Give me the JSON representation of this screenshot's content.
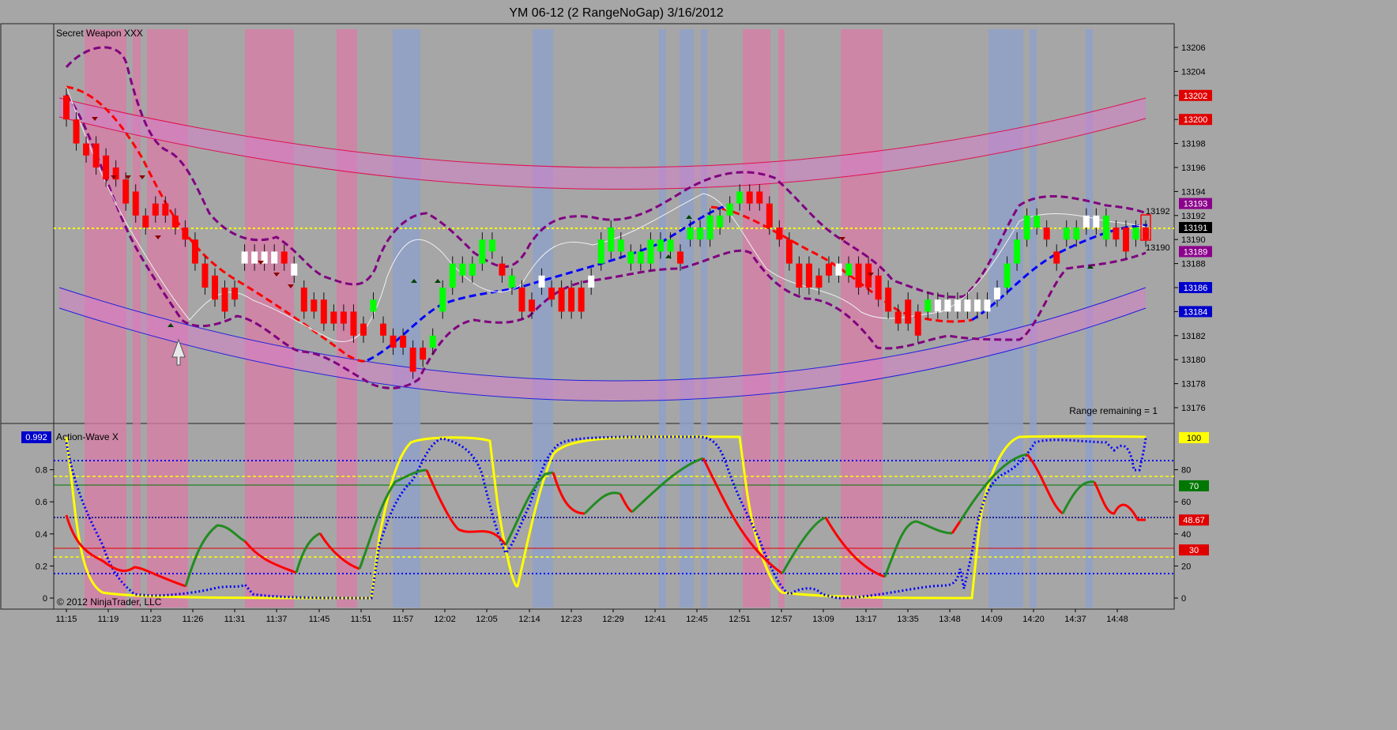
{
  "window": {
    "title": "YM 06-12 (2 RangeNoGap)  3/16/2012"
  },
  "price_panel": {
    "label": "Secret Weapon XXX",
    "range_text": "Range remaining = 1",
    "y_ticks": [
      "13206",
      "13204",
      "13202",
      "13200",
      "13198",
      "13196",
      "13194",
      "13192",
      "13190",
      "13188",
      "13186",
      "13184",
      "13182",
      "13180",
      "13178",
      "13176"
    ],
    "badges": [
      {
        "text": "13202",
        "color": "#e00000"
      },
      {
        "text": "13200",
        "color": "#e00000"
      },
      {
        "text": "13193",
        "color": "#8b008b"
      },
      {
        "text": "13191",
        "color": "#000000"
      },
      {
        "text": "13189",
        "color": "#8b008b"
      },
      {
        "text": "13186",
        "color": "#0000cc"
      },
      {
        "text": "13184",
        "color": "#0000cc"
      }
    ],
    "right_labels": [
      "13192",
      "13190"
    ]
  },
  "osc_panel": {
    "label": "Action-Wave X",
    "left_badge": "0.992",
    "copyright": "© 2012 NinjaTrader, LLC",
    "left_ticks": [
      "0.8",
      "0.6",
      "0.4",
      "0.2",
      "0"
    ],
    "right_ticks": [
      "80",
      "60",
      "40",
      "20",
      "0"
    ],
    "badges": [
      {
        "text": "100",
        "color": "#ffff00",
        "textColor": "#000000"
      },
      {
        "text": "70",
        "color": "#007700",
        "textColor": "#ffffff"
      },
      {
        "text": "48.67",
        "color": "#e00000",
        "textColor": "#ffffff"
      },
      {
        "text": "30",
        "color": "#e00000",
        "textColor": "#ffffff"
      }
    ]
  },
  "x_labels": [
    "11:15",
    "11:19",
    "11:23",
    "11:26",
    "11:31",
    "11:37",
    "11:45",
    "11:51",
    "11:57",
    "12:02",
    "12:05",
    "12:14",
    "12:23",
    "12:29",
    "12:41",
    "12:45",
    "12:51",
    "12:57",
    "13:09",
    "13:17",
    "13:35",
    "13:48",
    "14:09",
    "14:20",
    "14:37",
    "14:48"
  ],
  "chart_data": {
    "type": "candlestick",
    "title": "YM 06-12 (2 RangeNoGap)  3/16/2012",
    "price_range": [
      13175,
      13208
    ],
    "last_price": 13191,
    "colors": {
      "up": "#00ff00",
      "down": "#ff0000",
      "neutral": "#ffffff",
      "pink_zone": "#d97ba6",
      "blue_zone": "#8fa0c8"
    },
    "candles": [
      {
        "o": 13202,
        "c": 13200
      },
      {
        "o": 13200,
        "c": 13198
      },
      {
        "o": 13198,
        "c": 13197
      },
      {
        "o": 13198,
        "c": 13196
      },
      {
        "o": 13197,
        "c": 13195
      },
      {
        "o": 13196,
        "c": 13195
      },
      {
        "o": 13195,
        "c": 13193
      },
      {
        "o": 13194,
        "c": 13192
      },
      {
        "o": 13192,
        "c": 13191
      },
      {
        "o": 13193,
        "c": 13192
      },
      {
        "o": 13193,
        "c": 13192
      },
      {
        "o": 13192,
        "c": 13191
      },
      {
        "o": 13191,
        "c": 13190
      },
      {
        "o": 13190,
        "c": 13188
      },
      {
        "o": 13188,
        "c": 13186
      },
      {
        "o": 13187,
        "c": 13185
      },
      {
        "o": 13186,
        "c": 13184
      },
      {
        "o": 13186,
        "c": 13185
      },
      {
        "o": 13188,
        "c": 13189
      },
      {
        "o": 13188,
        "c": 13189
      },
      {
        "o": 13188,
        "c": 13189
      },
      {
        "o": 13188,
        "c": 13189
      },
      {
        "o": 13189,
        "c": 13188
      },
      {
        "o": 13187,
        "c": 13188
      },
      {
        "o": 13186,
        "c": 13184
      },
      {
        "o": 13185,
        "c": 13184
      },
      {
        "o": 13185,
        "c": 13183
      },
      {
        "o": 13184,
        "c": 13183
      },
      {
        "o": 13184,
        "c": 13183
      },
      {
        "o": 13184,
        "c": 13182
      },
      {
        "o": 13183,
        "c": 13182
      },
      {
        "o": 13184,
        "c": 13185
      },
      {
        "o": 13183,
        "c": 13182
      },
      {
        "o": 13182,
        "c": 13181
      },
      {
        "o": 13182,
        "c": 13181
      },
      {
        "o": 13181,
        "c": 13179
      },
      {
        "o": 13181,
        "c": 13180
      },
      {
        "o": 13181,
        "c": 13182
      },
      {
        "o": 13184,
        "c": 13186
      },
      {
        "o": 13186,
        "c": 13188
      },
      {
        "o": 13187,
        "c": 13188
      },
      {
        "o": 13187,
        "c": 13188
      },
      {
        "o": 13188,
        "c": 13190
      },
      {
        "o": 13189,
        "c": 13190
      },
      {
        "o": 13188,
        "c": 13187
      },
      {
        "o": 13186,
        "c": 13187
      },
      {
        "o": 13186,
        "c": 13184
      },
      {
        "o": 13185,
        "c": 13184
      },
      {
        "o": 13186,
        "c": 13187
      },
      {
        "o": 13186,
        "c": 13185
      },
      {
        "o": 13186,
        "c": 13184
      },
      {
        "o": 13186,
        "c": 13184
      },
      {
        "o": 13186,
        "c": 13184
      },
      {
        "o": 13186,
        "c": 13187
      },
      {
        "o": 13188,
        "c": 13190
      },
      {
        "o": 13189,
        "c": 13191
      },
      {
        "o": 13189,
        "c": 13190
      },
      {
        "o": 13188,
        "c": 13189
      },
      {
        "o": 13188,
        "c": 13189
      },
      {
        "o": 13188,
        "c": 13190
      },
      {
        "o": 13189,
        "c": 13190
      },
      {
        "o": 13189,
        "c": 13190
      },
      {
        "o": 13189,
        "c": 13188
      },
      {
        "o": 13190,
        "c": 13191
      },
      {
        "o": 13190,
        "c": 13191
      },
      {
        "o": 13190,
        "c": 13192
      },
      {
        "o": 13191,
        "c": 13192
      },
      {
        "o": 13192,
        "c": 13193
      },
      {
        "o": 13193,
        "c": 13194
      },
      {
        "o": 13194,
        "c": 13193
      },
      {
        "o": 13194,
        "c": 13193
      },
      {
        "o": 13193,
        "c": 13191
      },
      {
        "o": 13191,
        "c": 13190
      },
      {
        "o": 13190,
        "c": 13188
      },
      {
        "o": 13188,
        "c": 13186
      },
      {
        "o": 13188,
        "c": 13186
      },
      {
        "o": 13187,
        "c": 13186
      },
      {
        "o": 13188,
        "c": 13187
      },
      {
        "o": 13187,
        "c": 13188
      },
      {
        "o": 13187,
        "c": 13188
      },
      {
        "o": 13188,
        "c": 13186
      },
      {
        "o": 13188,
        "c": 13186
      },
      {
        "o": 13187,
        "c": 13185
      },
      {
        "o": 13186,
        "c": 13184
      },
      {
        "o": 13184,
        "c": 13183
      },
      {
        "o": 13185,
        "c": 13183
      },
      {
        "o": 13184,
        "c": 13182
      },
      {
        "o": 13184,
        "c": 13185
      },
      {
        "o": 13184,
        "c": 13185
      },
      {
        "o": 13184,
        "c": 13185
      },
      {
        "o": 13184,
        "c": 13185
      },
      {
        "o": 13184,
        "c": 13185
      },
      {
        "o": 13184,
        "c": 13185
      },
      {
        "o": 13184,
        "c": 13185
      },
      {
        "o": 13185,
        "c": 13186
      },
      {
        "o": 13186,
        "c": 13188
      },
      {
        "o": 13188,
        "c": 13190
      },
      {
        "o": 13190,
        "c": 13192
      },
      {
        "o": 13191,
        "c": 13192
      },
      {
        "o": 13191,
        "c": 13190
      },
      {
        "o": 13189,
        "c": 13188
      },
      {
        "o": 13190,
        "c": 13191
      },
      {
        "o": 13190,
        "c": 13191
      },
      {
        "o": 13191,
        "c": 13192
      },
      {
        "o": 13191,
        "c": 13192
      },
      {
        "o": 13190,
        "c": 13192
      },
      {
        "o": 13191,
        "c": 13190
      },
      {
        "o": 13191,
        "c": 13189
      },
      {
        "o": 13190,
        "c": 13191
      },
      {
        "o": 13191,
        "c": 13190
      }
    ]
  }
}
